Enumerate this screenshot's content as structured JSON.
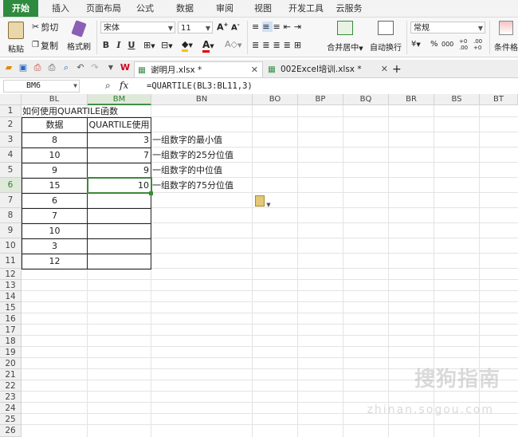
{
  "menu": {
    "items": [
      "开始",
      "插入",
      "页面布局",
      "公式",
      "数据",
      "审阅",
      "视图",
      "开发工具",
      "云服务"
    ]
  },
  "ribbon": {
    "paste": "粘贴",
    "cut": "剪切",
    "copy": "复制",
    "format_painter": "格式刷",
    "font_name": "宋体",
    "font_size": "11",
    "bold": "B",
    "italic": "I",
    "underline": "U",
    "merge_center": "合并居中",
    "wrap_text": "自动换行",
    "number_format": "常规",
    "conditional_format": "条件格",
    "percent": "%",
    "thousands": "000",
    "dec_inc": "+0 .00",
    "dec_dec": ".00 +0"
  },
  "tabs": {
    "doc1": "谢明月.xlsx *",
    "doc2": "002Excel培训.xlsx *",
    "add": "+"
  },
  "formula_bar": {
    "name_box": "BM6",
    "fx": "fx",
    "formula": "=QUARTILE(BL3:BL11,3)"
  },
  "columns": [
    "BL",
    "BM",
    "BN",
    "BO",
    "BP",
    "BQ",
    "BR",
    "BS",
    "BT"
  ],
  "rows": [
    "1",
    "2",
    "3",
    "4",
    "5",
    "6",
    "7",
    "8",
    "9",
    "10",
    "11",
    "12",
    "13",
    "14",
    "15",
    "16",
    "17",
    "18",
    "19",
    "20",
    "21",
    "22",
    "23",
    "24",
    "25",
    "26"
  ],
  "sheet": {
    "title": "如何使用QUARTILE函数",
    "header_data": "数据",
    "header_quartile": "QUARTILE使用",
    "data": [
      "8",
      "10",
      "9",
      "15",
      "6",
      "7",
      "10",
      "3",
      "12"
    ],
    "results": [
      "3",
      "7",
      "9",
      "10"
    ],
    "notes": [
      "一组数字的最小值",
      "一组数字的25分位值",
      "一组数字的中位值",
      "一组数字的75分位值"
    ]
  },
  "watermark": {
    "main": "搜狗指南",
    "sub": "zhinan.sogou.com"
  },
  "colors": {
    "accent": "#2e8b3e",
    "selected_header": "#dfe9d9"
  }
}
